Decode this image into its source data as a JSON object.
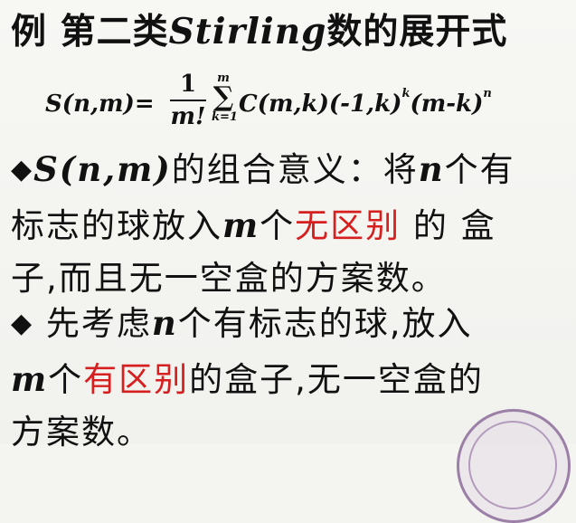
{
  "title": {
    "prefix": "例 第二类",
    "latin": "Stirling",
    "suffix": "数的展开式"
  },
  "formula": {
    "lhs": "S(n,m)=",
    "numerator": "1",
    "denominator": "m!",
    "sum_upper": "m",
    "sum_symbol": "∑",
    "sum_lower": "k=1",
    "body": "C(m,k)(-1,k)",
    "exp1": "k",
    "body2": "(m-k)",
    "exp2": "n"
  },
  "para1": {
    "bullet": "◆",
    "latin1": "S(n,m)",
    "text1": "的组合意义：将",
    "latin2": "n",
    "text2": "个有",
    "line2_text1": "标志的球放入",
    "line2_latin": "m",
    "line2_text2": "个",
    "line2_red": "无区别",
    "line2_text3": " 的 盒",
    "line3": "子,而且无一空盒的方案数。"
  },
  "para2": {
    "bullet": "◆",
    "text1": " 先考虑",
    "latin1": "n",
    "text2": "个有标志的球,放入",
    "line2_latin": "m",
    "line2_text1": "个",
    "line2_red": "有区别",
    "line2_text2": "的盒子,无一空盒的",
    "line3": "方案数。"
  },
  "colors": {
    "accent_red": "#d62020",
    "text": "#111111",
    "background": "#f4f4f1"
  }
}
